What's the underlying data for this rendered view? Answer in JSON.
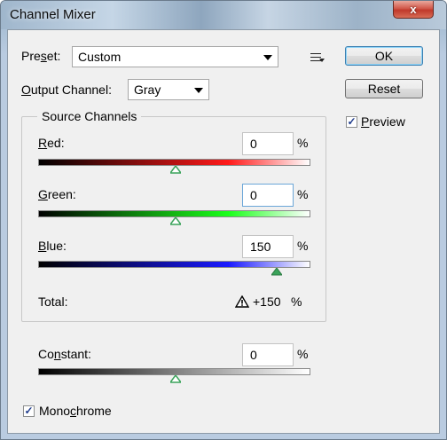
{
  "window": {
    "title": "Channel Mixer",
    "close_glyph": "x"
  },
  "preset": {
    "label_pre": "Pre",
    "label_key": "s",
    "label_post": "et:",
    "value": "Custom"
  },
  "output_channel": {
    "label_key": "O",
    "label_post": "utput Channel:",
    "value": "Gray"
  },
  "buttons": {
    "ok": "OK",
    "reset": "Reset"
  },
  "preview": {
    "label_key": "P",
    "label_post": "review",
    "checked": true,
    "check_glyph": "✓"
  },
  "source_channels": {
    "title": "Source Channels",
    "red": {
      "label_key": "R",
      "label_post": "ed:",
      "value": "0",
      "unit": "%",
      "percent": 0,
      "color": "#ff1a1a"
    },
    "green": {
      "label_key": "G",
      "label_post": "reen:",
      "value": "0",
      "unit": "%",
      "percent": 0,
      "color": "#1aff1a"
    },
    "blue": {
      "label_key": "B",
      "label_post": "lue:",
      "value": "150",
      "unit": "%",
      "percent": 150,
      "color": "#1a1aff"
    }
  },
  "total": {
    "label": "Total:",
    "value": "+150",
    "unit": "%",
    "warning_icon": "warning-triangle-icon"
  },
  "constant": {
    "label_pre": "Co",
    "label_key": "n",
    "label_post": "stant:",
    "value": "0",
    "unit": "%",
    "percent": 0
  },
  "monochrome": {
    "label_pre": "Mono",
    "label_key": "c",
    "label_post": "hrome",
    "checked": true,
    "check_glyph": "✓"
  },
  "colors": {
    "title_close": "#c0392b",
    "thumb": "#3aa35a",
    "focus_border": "#6ba6d8"
  }
}
